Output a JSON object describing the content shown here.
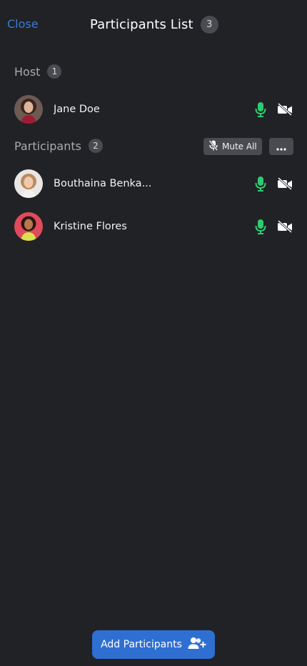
{
  "header": {
    "close_label": "Close",
    "title": "Participants List",
    "total_count": "3"
  },
  "host_section": {
    "label": "Host",
    "count": "1",
    "people": [
      {
        "name": "Jane Doe",
        "mic": "on",
        "video": "off"
      }
    ]
  },
  "participants_section": {
    "label": "Participants",
    "count": "2",
    "mute_all_label": "Mute All",
    "people": [
      {
        "name": "Bouthaina Benka...",
        "mic": "on",
        "video": "off"
      },
      {
        "name": "Kristine Flores",
        "mic": "on",
        "video": "off"
      }
    ]
  },
  "footer": {
    "add_label": "Add Participants"
  },
  "colors": {
    "accent": "#2f6fd2",
    "mic_on": "#2ecc71",
    "background": "#212226"
  },
  "icons": [
    "microphone-icon",
    "video-off-icon",
    "microphone-off-icon",
    "more-icon",
    "add-user-icon"
  ]
}
